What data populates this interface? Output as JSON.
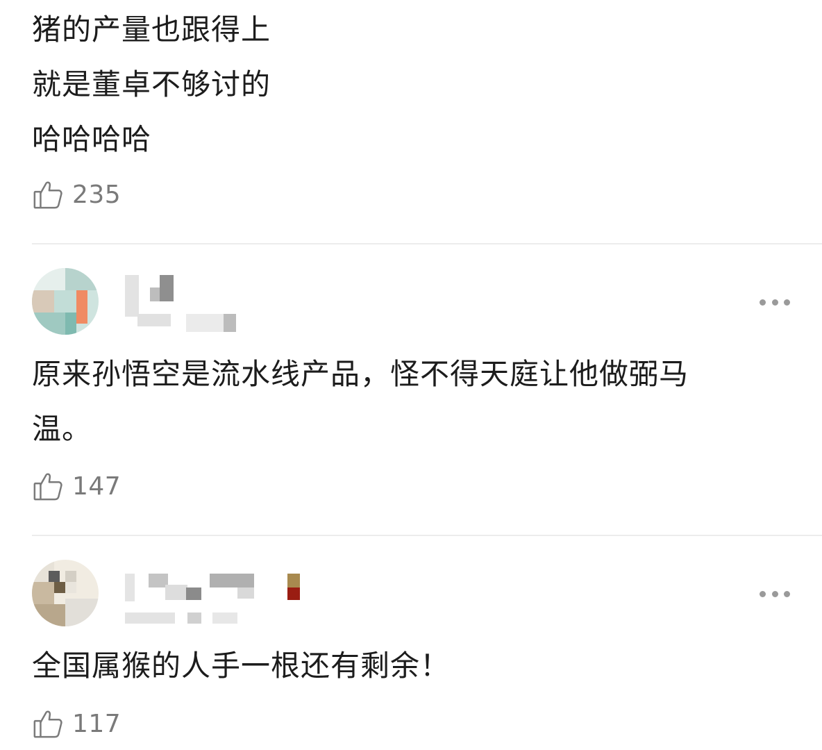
{
  "comments": [
    {
      "lines": [
        "猪的产量也跟得上",
        "就是董卓不够讨的",
        "哈哈哈哈"
      ],
      "likes": "235"
    },
    {
      "lines": [
        "原来孙悟空是流水线产品，怪不得天庭让他做弼马",
        "温。"
      ],
      "likes": "147"
    },
    {
      "lines": [
        "全国属猴的人手一根还有剩余！"
      ],
      "likes": "117"
    }
  ],
  "icons": {
    "like": "thumbs-up-outline-icon",
    "more": "more-horizontal-icon"
  },
  "colors": {
    "text": "#1c1c1c",
    "secondary": "#7a7a7a",
    "divider": "#ececec"
  }
}
